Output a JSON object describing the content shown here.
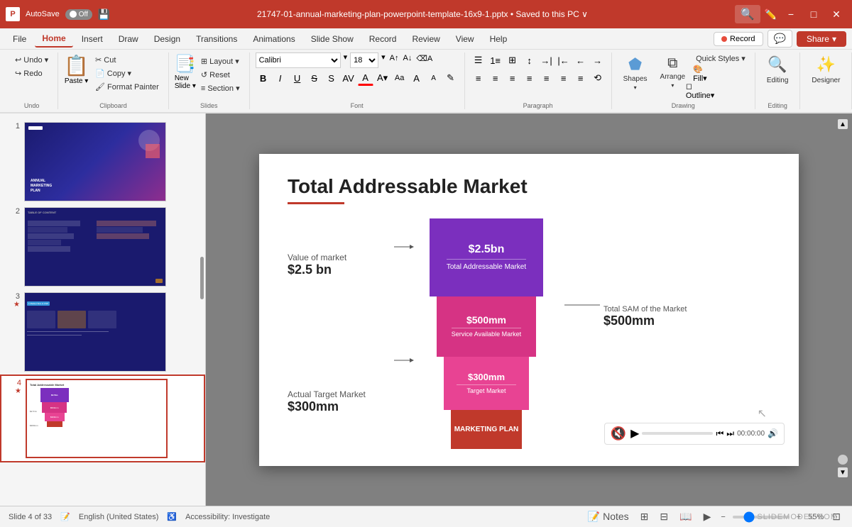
{
  "titlebar": {
    "app_icon": "P",
    "autosave_label": "AutoSave",
    "toggle_state": "Off",
    "file_name": "21747-01-annual-marketing-plan-powerpoint-template-16x9-1.pptx",
    "save_status": "Saved to this PC",
    "search_placeholder": "Search",
    "minimize_label": "−",
    "maximize_label": "□",
    "close_label": "✕"
  },
  "menubar": {
    "items": [
      {
        "label": "File",
        "active": false
      },
      {
        "label": "Home",
        "active": true
      },
      {
        "label": "Insert",
        "active": false
      },
      {
        "label": "Draw",
        "active": false
      },
      {
        "label": "Design",
        "active": false
      },
      {
        "label": "Transitions",
        "active": false
      },
      {
        "label": "Animations",
        "active": false
      },
      {
        "label": "Slide Show",
        "active": false
      },
      {
        "label": "Record",
        "active": false
      },
      {
        "label": "Review",
        "active": false
      },
      {
        "label": "View",
        "active": false
      },
      {
        "label": "Help",
        "active": false
      }
    ],
    "record_button": "Record",
    "comment_icon": "💬",
    "share_button": "Share",
    "share_dropdown": "▾"
  },
  "ribbon": {
    "groups": [
      {
        "name": "Undo",
        "label": "Undo",
        "controls": [
          "↩",
          "↪"
        ]
      },
      {
        "name": "Clipboard",
        "label": "Clipboard",
        "paste_label": "Paste",
        "controls": [
          "✂",
          "📋",
          "📌"
        ]
      },
      {
        "name": "Slides",
        "label": "Slides",
        "new_slide_label": "New Slide"
      },
      {
        "name": "Font",
        "label": "Font",
        "font_name": "Calibri",
        "font_size": "18",
        "bold": "B",
        "italic": "I",
        "underline": "U",
        "strikethrough": "S",
        "char_spacing": "AV"
      },
      {
        "name": "Paragraph",
        "label": "Paragraph"
      },
      {
        "name": "Drawing",
        "label": "Drawing",
        "shapes_label": "Shapes",
        "arrange_label": "Arrange",
        "quick_styles_label": "Quick Styles"
      },
      {
        "name": "Editing",
        "label": "Editing",
        "editing_label": "Editing"
      },
      {
        "name": "Designer",
        "label": "Designer",
        "designer_label": "Designer"
      }
    ]
  },
  "slides": [
    {
      "number": "1",
      "starred": false,
      "title": "ANNUAL MARKETING PLAN",
      "type": "cover"
    },
    {
      "number": "2",
      "starred": false,
      "title": "TABLE OF CONTENT",
      "type": "toc"
    },
    {
      "number": "3",
      "starred": true,
      "title": "Market Size & USP",
      "type": "market"
    },
    {
      "number": "4",
      "starred": true,
      "title": "Total Addressable Market",
      "type": "tam",
      "active": true
    }
  ],
  "slide": {
    "title": "Total Addressable Market",
    "underline_color": "#c0392b",
    "left_labels": [
      {
        "label": "Value of market",
        "value": "$2.5 bn"
      },
      {
        "label": "Actual Target Market",
        "value": "$300mm"
      }
    ],
    "right_labels": [
      {
        "label": "Total SAM of the Market",
        "value": "$500mm"
      }
    ],
    "bars": [
      {
        "title": "$2.5bn",
        "subtitle": "Total Addressable Market",
        "color": "#7b2fbe",
        "height": 120
      },
      {
        "title": "$500mm",
        "subtitle": "Service Available Market",
        "color": "#d63384",
        "height": 90
      },
      {
        "title": "$300mm",
        "subtitle": "Target Market",
        "color": "#d63384",
        "height": 80
      },
      {
        "title": "MARKETING PLAN",
        "subtitle": "",
        "color": "#c0392b",
        "height": 50
      }
    ]
  },
  "audio": {
    "time": "00:00:00",
    "volume_icon": "🔊"
  },
  "statusbar": {
    "slide_info": "Slide 4 of 33",
    "language": "English (United States)",
    "accessibility": "Accessibility: Investigate",
    "notes_label": "Notes",
    "zoom_level": "55%",
    "zoom_value": 55
  },
  "branding": {
    "watermark": "SLIDEMODEL.COM"
  }
}
